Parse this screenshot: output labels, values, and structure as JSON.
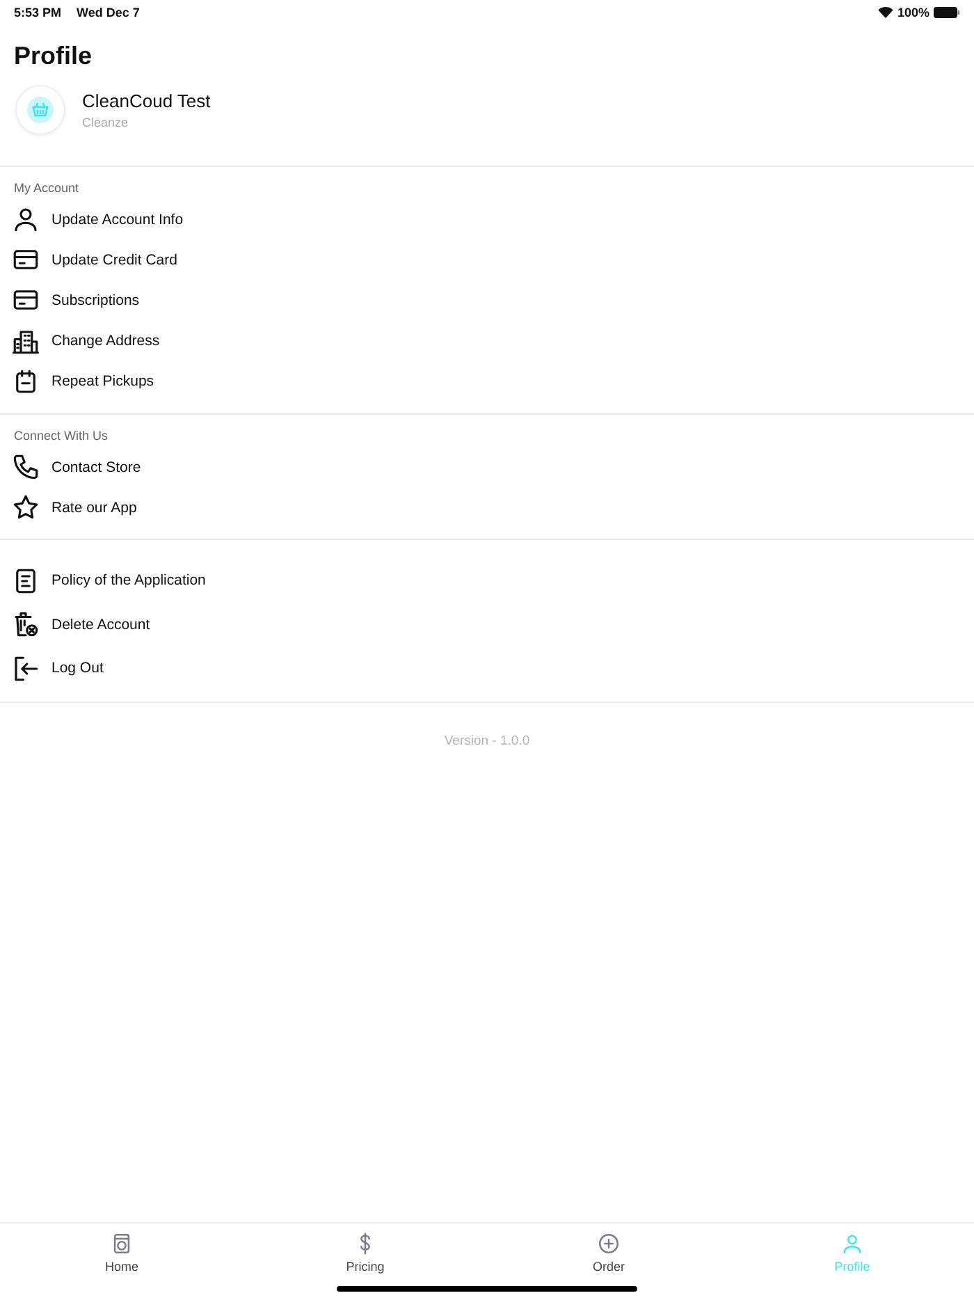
{
  "status_bar": {
    "time": "5:53 PM",
    "date": "Wed Dec 7",
    "battery": "100%"
  },
  "title": "Profile",
  "profile": {
    "name": "CleanCoud Test",
    "subtitle": "Cleanze"
  },
  "sections": [
    {
      "label": "My Account",
      "items": [
        {
          "label": "Update Account Info",
          "kind": "person"
        },
        {
          "label": "Update Credit Card",
          "kind": "card"
        },
        {
          "label": "Subscriptions",
          "kind": "card"
        },
        {
          "label": "Change Address",
          "kind": "building"
        },
        {
          "label": "Repeat Pickups",
          "kind": "calendar"
        }
      ]
    },
    {
      "label": "Connect With Us",
      "items": [
        {
          "label": "Contact Store",
          "kind": "phone"
        },
        {
          "label": "Rate our App",
          "kind": "star"
        }
      ]
    },
    {
      "items": [
        {
          "label": "Policy of the Application",
          "kind": "document"
        },
        {
          "label": "Delete Account",
          "kind": "trash"
        },
        {
          "label": "Log Out",
          "kind": "logout"
        }
      ]
    }
  ],
  "version": "Version - 1.0.0",
  "tabs": [
    {
      "label": "Home",
      "kind": "washer",
      "selected": false
    },
    {
      "label": "Pricing",
      "kind": "dollar",
      "selected": false
    },
    {
      "label": "Order",
      "kind": "plus",
      "selected": false
    },
    {
      "label": "Profile",
      "kind": "person",
      "selected": true
    }
  ]
}
